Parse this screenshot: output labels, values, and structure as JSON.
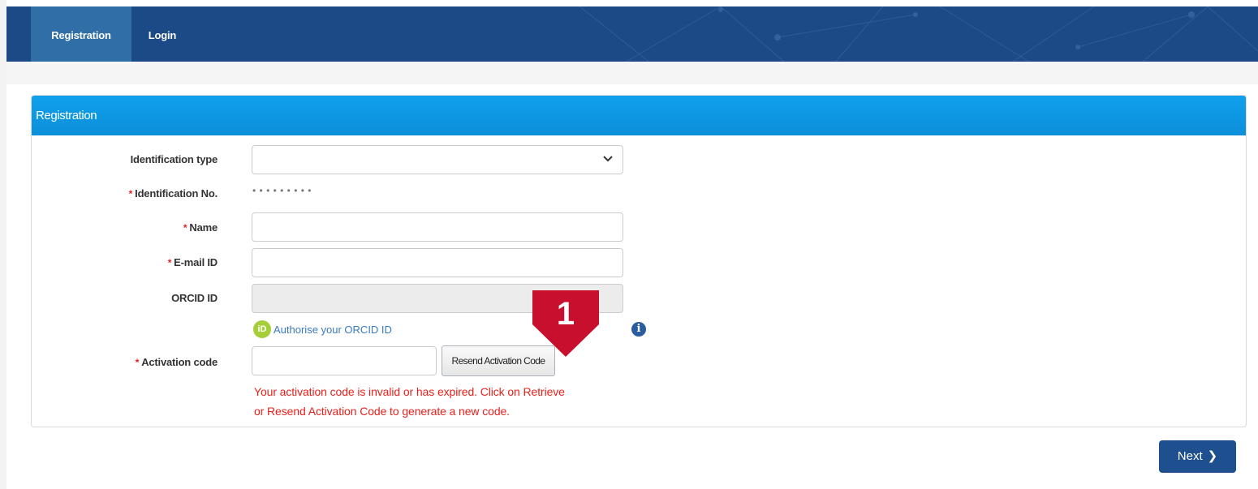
{
  "nav": {
    "tabs": [
      {
        "label": "Registration",
        "active": true
      },
      {
        "label": "Login",
        "active": false
      }
    ]
  },
  "panel": {
    "title": "Registration"
  },
  "form": {
    "identification_type": {
      "label": "Identification type",
      "value": ""
    },
    "identification_no": {
      "label": "Identification No.",
      "value": "• • • • • • • • •"
    },
    "name": {
      "label": "Name",
      "value": ""
    },
    "email": {
      "label": "E-mail ID",
      "value": ""
    },
    "orcid": {
      "label": "ORCID ID",
      "value": "",
      "authorise_label": "Authorise your ORCID ID",
      "badge": "iD"
    },
    "activation_code": {
      "label": "Activation code",
      "value": "",
      "resend_label": "Resend Activation Code"
    },
    "error": {
      "line1": "Your activation code is invalid or has expired. Click on Retrieve",
      "line2": "or Resend Activation Code to generate a new code."
    },
    "required_marker": "*"
  },
  "callout": {
    "number": "1",
    "color": "#c8102e"
  },
  "actions": {
    "next_label": "Next",
    "next_chevron": "❯"
  },
  "icons": {
    "info": "info-icon",
    "dropdown": "chevron-down-icon",
    "orcid": "orcid-icon"
  },
  "colors": {
    "navbar": "#1c4a87",
    "active_tab": "#2f6ea7",
    "panel_header": "#10a0ec",
    "error": "#e8201c",
    "next_button": "#1e4f8e"
  }
}
